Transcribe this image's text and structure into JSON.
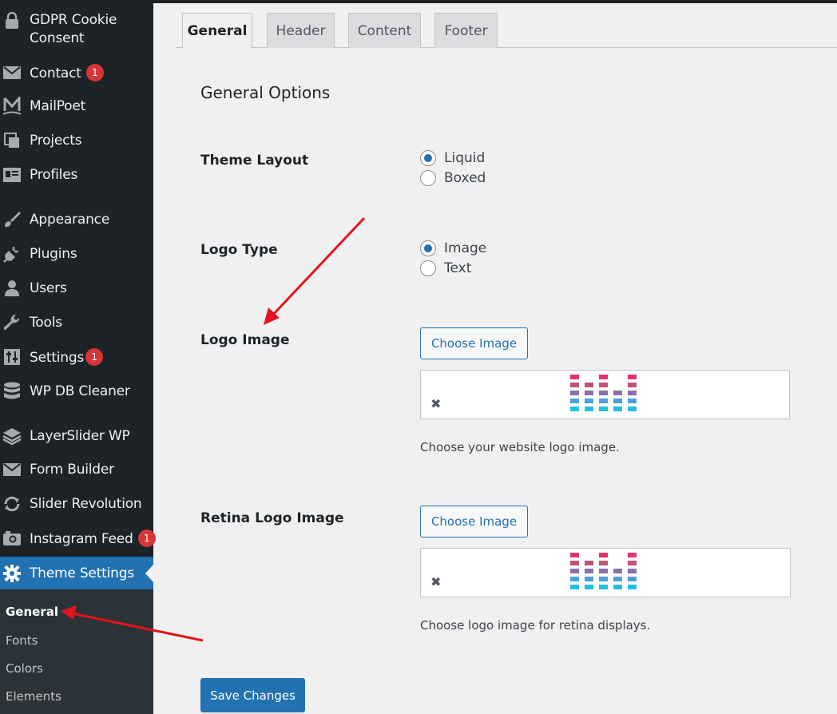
{
  "sidebar": {
    "items": [
      {
        "label": "GDPR Cookie Consent",
        "icon": "lock-icon"
      },
      {
        "label": "Contact",
        "icon": "envelope-icon",
        "badge": "1"
      },
      {
        "label": "MailPoet",
        "icon": "mailpoet-icon"
      },
      {
        "label": "Projects",
        "icon": "portfolio-icon"
      },
      {
        "label": "Profiles",
        "icon": "id-card-icon"
      },
      {
        "label": "Appearance",
        "icon": "paintbrush-icon"
      },
      {
        "label": "Plugins",
        "icon": "plugin-icon"
      },
      {
        "label": "Users",
        "icon": "user-icon"
      },
      {
        "label": "Tools",
        "icon": "wrench-icon"
      },
      {
        "label": "Settings",
        "icon": "settings-sliders-icon",
        "badge": "1"
      },
      {
        "label": "WP DB Cleaner",
        "icon": "database-icon"
      },
      {
        "label": "LayerSlider WP",
        "icon": "layers-icon"
      },
      {
        "label": "Form Builder",
        "icon": "envelope-icon"
      },
      {
        "label": "Slider Revolution",
        "icon": "refresh-icon"
      },
      {
        "label": "Instagram Feed",
        "icon": "camera-icon",
        "badge": "1"
      },
      {
        "label": "Theme Settings",
        "icon": "gear-icon"
      }
    ],
    "submenu": [
      "General",
      "Fonts",
      "Colors",
      "Elements"
    ]
  },
  "tabs": [
    "General",
    "Header",
    "Content",
    "Footer"
  ],
  "main": {
    "section_title": "General Options",
    "theme_layout": {
      "label": "Theme Layout",
      "options": [
        "Liquid",
        "Boxed"
      ],
      "selected": "Liquid"
    },
    "logo_type": {
      "label": "Logo Type",
      "options": [
        "Image",
        "Text"
      ],
      "selected": "Image"
    },
    "logo_image": {
      "label": "Logo Image",
      "button": "Choose Image",
      "remove": "✖",
      "description": "Choose your website logo image."
    },
    "retina_logo_image": {
      "label": "Retina Logo Image",
      "button": "Choose Image",
      "remove": "✖",
      "description": "Choose logo image for retina displays."
    },
    "save_label": "Save Changes"
  },
  "colors": {
    "sidebar": "#1d2327",
    "accent": "#2271b1",
    "badge": "#d63638",
    "arrow": "#e3141b"
  }
}
